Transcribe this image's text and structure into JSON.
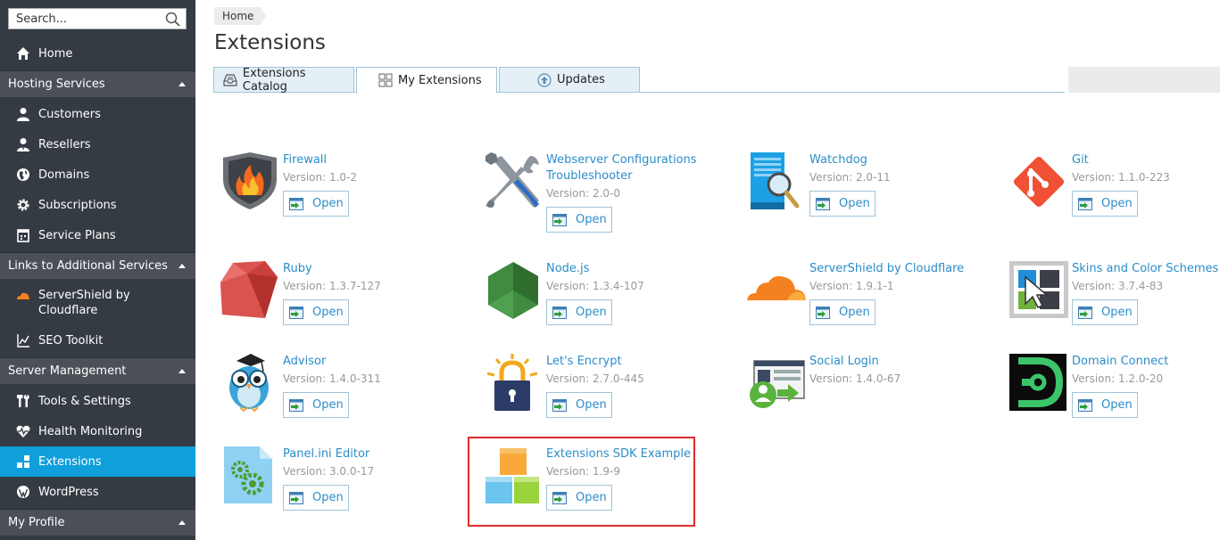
{
  "search": {
    "placeholder": "Search..."
  },
  "sidebar": {
    "home": "Home",
    "groups": {
      "hosting": "Hosting Services",
      "links": "Links to Additional Services",
      "server": "Server Management",
      "profile": "My Profile"
    },
    "items": {
      "customers": "Customers",
      "resellers": "Resellers",
      "domains": "Domains",
      "subscriptions": "Subscriptions",
      "service_plans": "Service Plans",
      "servershield": "ServerShield by Cloudflare",
      "seo": "SEO Toolkit",
      "tools": "Tools & Settings",
      "health": "Health Monitoring",
      "extensions": "Extensions",
      "wordpress": "WordPress"
    },
    "active": "Extensions",
    "accent_color": "#0f9fdb"
  },
  "breadcrumb": "Home",
  "page_title": "Extensions",
  "tabs": {
    "catalog": "Extensions Catalog",
    "my": "My Extensions",
    "updates": "Updates",
    "active": "My Extensions"
  },
  "open_label": "Open",
  "extensions": {
    "firewall": {
      "name": "Firewall",
      "version": "Version: 1.0-2",
      "icon": "firewall-shield-icon"
    },
    "webserver": {
      "name": "Webserver Configurations Troubleshooter",
      "version": "Version: 2.0-0",
      "icon": "wrench-screwdriver-icon"
    },
    "watchdog": {
      "name": "Watchdog",
      "version": "Version: 2.0-11",
      "icon": "server-magnifier-icon"
    },
    "git": {
      "name": "Git",
      "version": "Version: 1.1.0-223",
      "icon": "git-icon"
    },
    "ruby": {
      "name": "Ruby",
      "version": "Version: 1.3.7-127",
      "icon": "ruby-gem-icon"
    },
    "nodejs": {
      "name": "Node.js",
      "version": "Version: 1.3.4-107",
      "icon": "nodejs-hexagon-icon"
    },
    "cloudflare": {
      "name": "ServerShield by Cloudflare",
      "version": "Version: 1.9.1-1",
      "icon": "cloudflare-cloud-icon"
    },
    "skins": {
      "name": "Skins and Color Schemes",
      "version": "Version: 3.7.4-83",
      "icon": "skins-cursor-icon"
    },
    "advisor": {
      "name": "Advisor",
      "version": "Version: 1.4.0-311",
      "icon": "owl-icon"
    },
    "letsencrypt": {
      "name": "Let's Encrypt",
      "version": "Version: 2.7.0-445",
      "icon": "padlock-icon"
    },
    "social": {
      "name": "Social Login",
      "version": "Version: 1.4.0-67",
      "icon": "social-login-icon"
    },
    "domainconnect": {
      "name": "Domain Connect",
      "version": "Version: 1.2.0-20",
      "icon": "domain-connect-icon"
    },
    "panelini": {
      "name": "Panel.ini Editor",
      "version": "Version: 3.0.0-17",
      "icon": "gears-file-icon"
    },
    "sdk": {
      "name": "Extensions SDK Example",
      "version": "Version: 1.9-9",
      "icon": "colored-blocks-icon"
    }
  }
}
